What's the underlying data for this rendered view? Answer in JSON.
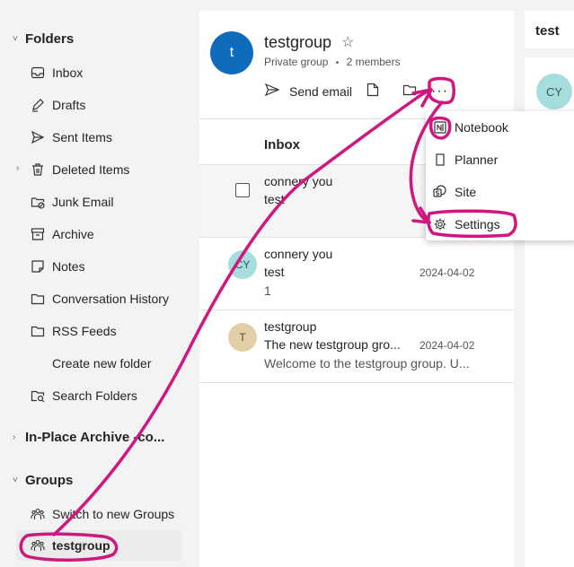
{
  "sidebar": {
    "folders_heading": "Folders",
    "items": [
      {
        "label": "Inbox",
        "icon": "inbox-icon"
      },
      {
        "label": "Drafts",
        "icon": "pencil-icon"
      },
      {
        "label": "Sent Items",
        "icon": "send-icon"
      },
      {
        "label": "Deleted Items",
        "icon": "trash-icon"
      },
      {
        "label": "Junk Email",
        "icon": "junk-folder-icon"
      },
      {
        "label": "Archive",
        "icon": "archive-icon"
      },
      {
        "label": "Notes",
        "icon": "note-icon"
      },
      {
        "label": "Conversation History",
        "icon": "folder-icon"
      },
      {
        "label": "RSS Feeds",
        "icon": "folder-icon"
      },
      {
        "label": "Create new folder",
        "icon": ""
      },
      {
        "label": "Search Folders",
        "icon": "search-folder-icon"
      }
    ],
    "archive_heading": "In-Place Archive -co...",
    "groups_heading": "Groups",
    "groups": [
      {
        "label": "Switch to new Groups",
        "icon": "people-icon"
      },
      {
        "label": "testgroup",
        "icon": "people-icon"
      }
    ]
  },
  "group": {
    "avatar_letter": "t",
    "name": "testgroup",
    "type": "Private group",
    "members": "2 members",
    "send_email": "Send email"
  },
  "list": {
    "heading": "Inbox",
    "messages": [
      {
        "from": "connery you",
        "subject": "test",
        "preview": "",
        "date": "",
        "avatar": ""
      },
      {
        "from": "connery you",
        "subject": "test",
        "preview": "1",
        "date": "2024-04-02",
        "avatar": "CY"
      },
      {
        "from": "testgroup",
        "subject": "The new testgroup gro...",
        "preview": "Welcome to the testgroup group. U...",
        "date": "2024-04-02",
        "avatar": "T"
      }
    ]
  },
  "reading": {
    "subject": "test",
    "avatar": "CY"
  },
  "more_menu": {
    "items": [
      {
        "label": "Notebook",
        "icon": "onenote-icon"
      },
      {
        "label": "Planner",
        "icon": "planner-icon"
      },
      {
        "label": "Site",
        "icon": "sharepoint-icon"
      },
      {
        "label": "Settings",
        "icon": "gear-icon"
      }
    ]
  },
  "colors": {
    "accent": "#0f6cbd",
    "annotation": "#d0177f",
    "avatar_cy": "#a7dddc",
    "avatar_t": "#e3cfa5"
  }
}
